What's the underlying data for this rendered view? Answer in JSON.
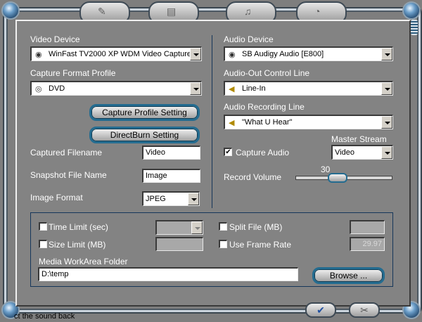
{
  "colors": {
    "panel": "#7e7e7e",
    "accent": "#246c90",
    "knob": "#2d5a80"
  },
  "top_tabs": [
    {
      "icon": "capture-tab-icon"
    },
    {
      "icon": "image-tab-icon"
    },
    {
      "icon": "audio-tab-icon"
    },
    {
      "icon": "schedule-tab-icon"
    }
  ],
  "video": {
    "device_label": "Video Device",
    "device_value": "WinFast TV2000 XP WDM Video Capture",
    "profile_label": "Capture Format Profile",
    "profile_value": "DVD",
    "profile_setting_btn": "Capture Profile Setting",
    "directburn_btn": "DirectBurn Setting",
    "filename_label": "Captured Filename",
    "filename_value": "Video",
    "snapshot_label": "Snapshot File Name",
    "snapshot_value": "Image",
    "format_label": "Image Format",
    "format_value": "JPEG"
  },
  "audio": {
    "device_label": "Audio Device",
    "device_value": "SB Audigy Audio [E800]",
    "out_label": "Audio-Out Control Line",
    "out_value": "Line-In",
    "rec_label": "Audio Recording Line",
    "rec_value": "\"What U Hear\"",
    "master_label": "Master Stream",
    "capture_label": "Capture Audio",
    "capture_checked": "✔",
    "master_value": "Video",
    "volume_label": "Record Volume",
    "volume_value": "30"
  },
  "options": {
    "time_limit_label": "Time Limit (sec)",
    "size_limit_label": "Size Limit (MB)",
    "split_label": "Split File (MB)",
    "frame_rate_label": "Use Frame Rate",
    "frame_rate_value": "29.97",
    "folder_label": "Media WorkArea Folder",
    "folder_value": "D:\\temp",
    "browse_btn": "Browse ..."
  },
  "footer": {
    "ok_icon": "check-icon",
    "cancel_icon": "tools-icon",
    "behind_text": "ct the sound back"
  }
}
